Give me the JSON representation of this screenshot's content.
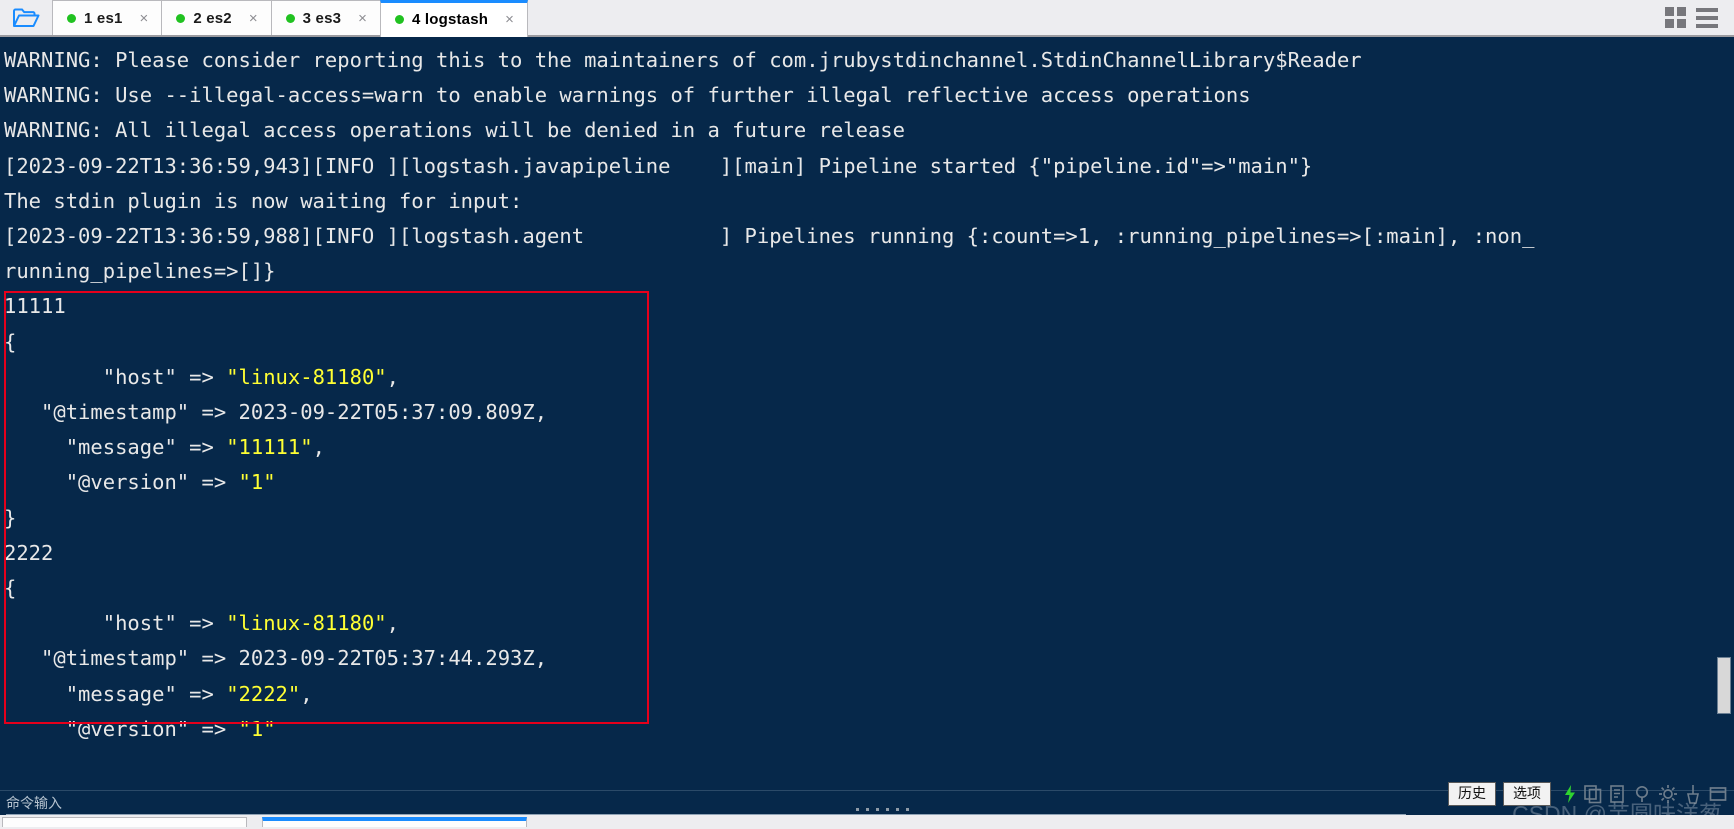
{
  "window": {
    "folder_icon": "open-folder-icon",
    "grid_icon": "grid-view-icon",
    "menu_icon": "hamburger-menu-icon"
  },
  "tabs": [
    {
      "index": "1",
      "title": "1 es1",
      "status": "connected",
      "close": "×",
      "active": false
    },
    {
      "index": "2",
      "title": "2 es2",
      "status": "connected",
      "close": "×",
      "active": false
    },
    {
      "index": "3",
      "title": "3 es3",
      "status": "connected",
      "close": "×",
      "active": false
    },
    {
      "index": "4",
      "title": "4 logstash",
      "status": "connected",
      "close": "×",
      "active": true
    }
  ],
  "terminal": {
    "background_color": "#06284a",
    "foreground_color": "#e8e8e8",
    "highlight_color": "#ffff33",
    "annotation_box_color": "#e5001b",
    "lines_pre": "WARNING: Please consider reporting this to the maintainers of com.jrubystdinchannel.StdinChannelLibrary$Reader\nWARNING: Use --illegal-access=warn to enable warnings of further illegal reflective access operations\nWARNING: All illegal access operations will be denied in a future release\n[2023-09-22T13:36:59,943][INFO ][logstash.javapipeline    ][main] Pipeline started {\"pipeline.id\"=>\"main\"}\nThe stdin plugin is now waiting for input:\n[2023-09-22T13:36:59,988][INFO ][logstash.agent           ] Pipelines running {:count=>1, :running_pipelines=>[:main], :non_\nrunning_pipelines=>[]}",
    "event_1": {
      "input_echo": "11111",
      "open_brace": "{",
      "fields": [
        {
          "key": "\"host\"",
          "arrow": "=>",
          "value": "\"linux-81180\"",
          "trailing": ",",
          "highlight": true
        },
        {
          "key": "\"@timestamp\"",
          "arrow": "=>",
          "value": "2023-09-22T05:37:09.809Z",
          "trailing": ",",
          "highlight": false
        },
        {
          "key": "\"message\"",
          "arrow": "=>",
          "value": "\"11111\"",
          "trailing": ",",
          "highlight": true
        },
        {
          "key": "\"@version\"",
          "arrow": "=>",
          "value": "\"1\"",
          "trailing": "",
          "highlight": true
        }
      ],
      "close_brace": "}"
    },
    "event_2": {
      "input_echo": "2222",
      "open_brace": "{",
      "fields": [
        {
          "key": "\"host\"",
          "arrow": "=>",
          "value": "\"linux-81180\"",
          "trailing": ",",
          "highlight": true
        },
        {
          "key": "\"@timestamp\"",
          "arrow": "=>",
          "value": "2023-09-22T05:37:44.293Z",
          "trailing": ",",
          "highlight": false
        },
        {
          "key": "\"message\"",
          "arrow": "=>",
          "value": "\"2222\"",
          "trailing": ",",
          "highlight": true
        },
        {
          "key": "\"@version\"",
          "arrow": "=>",
          "value": "\"1\"",
          "trailing": "",
          "highlight": true
        }
      ]
    }
  },
  "command_bar": {
    "placeholder": "命令输入",
    "value": "",
    "history_button": "历史",
    "options_button": "选项",
    "tray_icons": [
      "lightning-icon",
      "copy-icon",
      "paste-icon",
      "search-icon",
      "gear-icon",
      "broom-icon",
      "window-icon"
    ]
  },
  "watermark": "CSDN @芋圆味洋葱"
}
